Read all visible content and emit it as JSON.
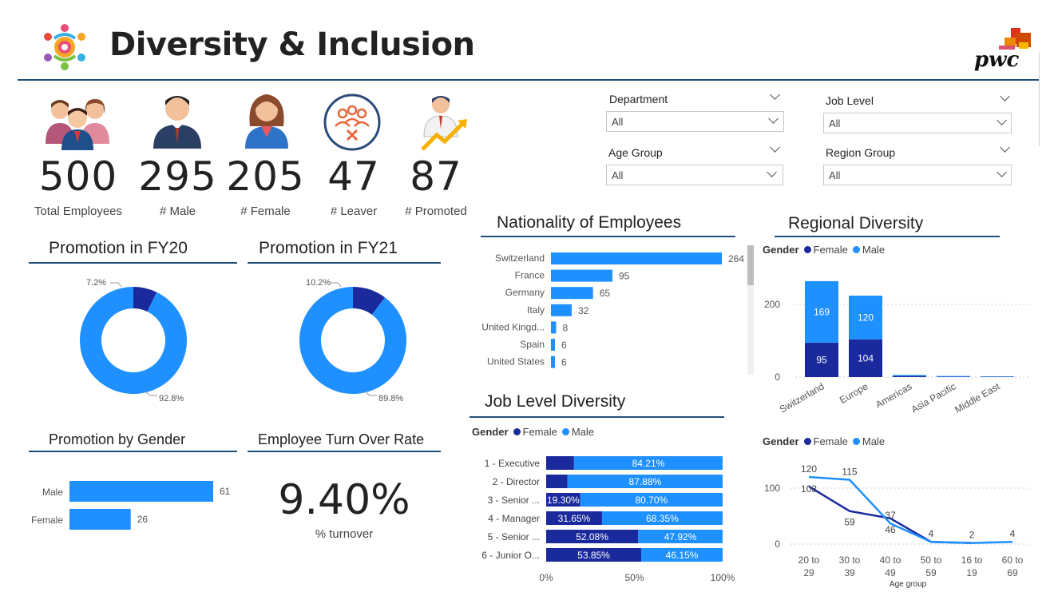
{
  "header": {
    "title": "Diversity & Inclusion",
    "brand": "pwc"
  },
  "colors": {
    "male": "#1e90ff",
    "female": "#1a2a9c",
    "accent_line": "#1f4e79"
  },
  "kpis": [
    {
      "value": "500",
      "label": "Total Employees",
      "icon": "employees-group-icon"
    },
    {
      "value": "295",
      "label": "# Male",
      "icon": "male-icon"
    },
    {
      "value": "205",
      "label": "# Female",
      "icon": "female-icon"
    },
    {
      "value": "47",
      "label": "# Leaver",
      "icon": "leaver-icon"
    },
    {
      "value": "87",
      "label": "# Promoted",
      "icon": "promoted-icon"
    }
  ],
  "filters": [
    {
      "title": "Department",
      "value": "All"
    },
    {
      "title": "Job Level",
      "value": "All"
    },
    {
      "title": "Age Group",
      "value": "All"
    },
    {
      "title": "Region Group",
      "value": "All"
    }
  ],
  "sections": {
    "promo_fy20": "Promotion in FY20",
    "promo_fy21": "Promotion in FY21",
    "promo_gender": "Promotion by Gender",
    "turnover": "Employee Turn Over Rate",
    "nationality": "Nationality of Employees",
    "job_level": "Job Level Diversity",
    "regional": "Regional Diversity"
  },
  "turnover": {
    "value": "9.40%",
    "label": "% turnover"
  },
  "legend": {
    "title": "Gender",
    "female": "Female",
    "male": "Male"
  },
  "chart_data": [
    {
      "id": "promo_fy20",
      "type": "pie",
      "labels": [
        "Promoted",
        "Not promoted"
      ],
      "values": [
        7.2,
        92.8
      ],
      "label_texts": [
        "7.2%",
        "92.8%"
      ]
    },
    {
      "id": "promo_fy21",
      "type": "pie",
      "labels": [
        "Promoted",
        "Not promoted"
      ],
      "values": [
        10.2,
        89.8
      ],
      "label_texts": [
        "10.2%",
        "89.8%"
      ]
    },
    {
      "id": "promo_gender",
      "type": "bar",
      "categories": [
        "Male",
        "Female"
      ],
      "values": [
        61,
        26
      ]
    },
    {
      "id": "nationality",
      "type": "bar",
      "categories": [
        "Switzerland",
        "France",
        "Germany",
        "Italy",
        "United Kingd...",
        "Spain",
        "United States"
      ],
      "values": [
        264,
        95,
        65,
        32,
        8,
        6,
        6
      ]
    },
    {
      "id": "job_level",
      "type": "bar",
      "categories": [
        "1 - Executive",
        "2 - Director",
        "3 - Senior ...",
        "4 - Manager",
        "5 - Senior ...",
        "6 - Junior O..."
      ],
      "series": [
        {
          "name": "Female",
          "values": [
            15.79,
            12.12,
            19.3,
            31.65,
            52.08,
            53.85
          ],
          "labels": [
            "",
            "",
            "19.30%",
            "31.65%",
            "52.08%",
            "53.85%"
          ]
        },
        {
          "name": "Male",
          "values": [
            84.21,
            87.88,
            80.7,
            68.35,
            47.92,
            46.15
          ],
          "labels": [
            "84.21%",
            "87.88%",
            "80.70%",
            "68.35%",
            "47.92%",
            "46.15%"
          ]
        }
      ],
      "xticks": [
        "0%",
        "50%",
        "100%"
      ]
    },
    {
      "id": "regional",
      "type": "bar",
      "categories": [
        "Switzerland",
        "Europe",
        "Americas",
        "Asia Pacific",
        "Middle East"
      ],
      "series": [
        {
          "name": "Female",
          "values": [
            95,
            104,
            3,
            1,
            1
          ],
          "labels": [
            "95",
            "104",
            "",
            "",
            ""
          ]
        },
        {
          "name": "Male",
          "values": [
            169,
            120,
            3,
            2,
            1
          ],
          "labels": [
            "169",
            "120",
            "",
            "",
            ""
          ]
        }
      ],
      "yticks": [
        "0",
        "200"
      ],
      "ylim": [
        0,
        300
      ]
    },
    {
      "id": "age_group",
      "type": "line",
      "categories": [
        "20 to 29",
        "30 to 39",
        "40 to 49",
        "50 to 59",
        "16 to 19",
        "60 to 69"
      ],
      "series": [
        {
          "name": "Female",
          "values": [
            103,
            59,
            46,
            4,
            2,
            null
          ]
        },
        {
          "name": "Male",
          "values": [
            120,
            115,
            37,
            4,
            2,
            4
          ]
        }
      ],
      "point_labels": {
        "Female": [
          "103",
          "59",
          "46",
          "",
          "",
          ""
        ],
        "Male": [
          "120",
          "115",
          "37",
          "4",
          "2",
          "4"
        ]
      },
      "yticks": [
        "0",
        "100"
      ],
      "xlabel": "Age group",
      "ylim": [
        0,
        130
      ]
    }
  ]
}
